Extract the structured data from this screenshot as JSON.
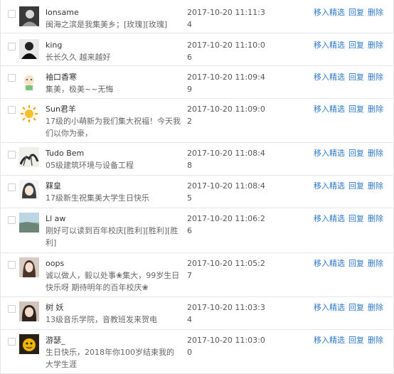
{
  "actions": {
    "feature": "移入精选",
    "reply": "回复",
    "delete": "删除"
  },
  "comments": [
    {
      "name": "lonsame",
      "content": "闽海之滨是我集美乡；[玫瑰][玫瑰]",
      "time": "2017-10-20 11:11:34",
      "avatar": "dark-portrait-avatar"
    },
    {
      "name": "king",
      "content": "长长久久 越来越好",
      "time": "2017-10-20 11:10:06",
      "avatar": "black-portrait-avatar"
    },
    {
      "name": "袖口香寒",
      "content": "集美，极美~~无悔",
      "time": "2017-10-20 11:09:49",
      "avatar": "cartoon-character-avatar"
    },
    {
      "name": "Sun君羊",
      "content": "17级的小萌新为我们集大祝福！今天我们以你为豪，",
      "time": "2017-10-20 11:09:02",
      "avatar": "sun-avatar"
    },
    {
      "name": "Tudo Bem",
      "content": "05级建筑环境与设备工程",
      "time": "2017-10-20 11:08:48",
      "avatar": "ink-painting-avatar"
    },
    {
      "name": "槑皇",
      "content": "17级新生祝集美大学生日快乐",
      "time": "2017-10-20 11:08:45",
      "avatar": "anime-girl-avatar"
    },
    {
      "name": "Ll aw",
      "content": "刚好可以读到百年校庆[胜利][胜利][胜利]",
      "time": "2017-10-20 11:06:26",
      "avatar": "landscape-avatar"
    },
    {
      "name": "oops",
      "content": "诚以做人，毅以处事❀集大，99岁生日快乐呀 期待明年的百年校庆❀",
      "time": "2017-10-20 11:05:27",
      "avatar": "woman-portrait-avatar"
    },
    {
      "name": "树 妖",
      "content": "13级音乐学院，音教班发来贺电",
      "time": "2017-10-20 11:03:34",
      "avatar": "girl-portrait-avatar"
    },
    {
      "name": "游瑟_",
      "content": "生日快乐，2018年你100岁结束我的大学生涯",
      "time": "2017-10-20 11:03:00",
      "avatar": "yellow-character-avatar"
    }
  ]
}
